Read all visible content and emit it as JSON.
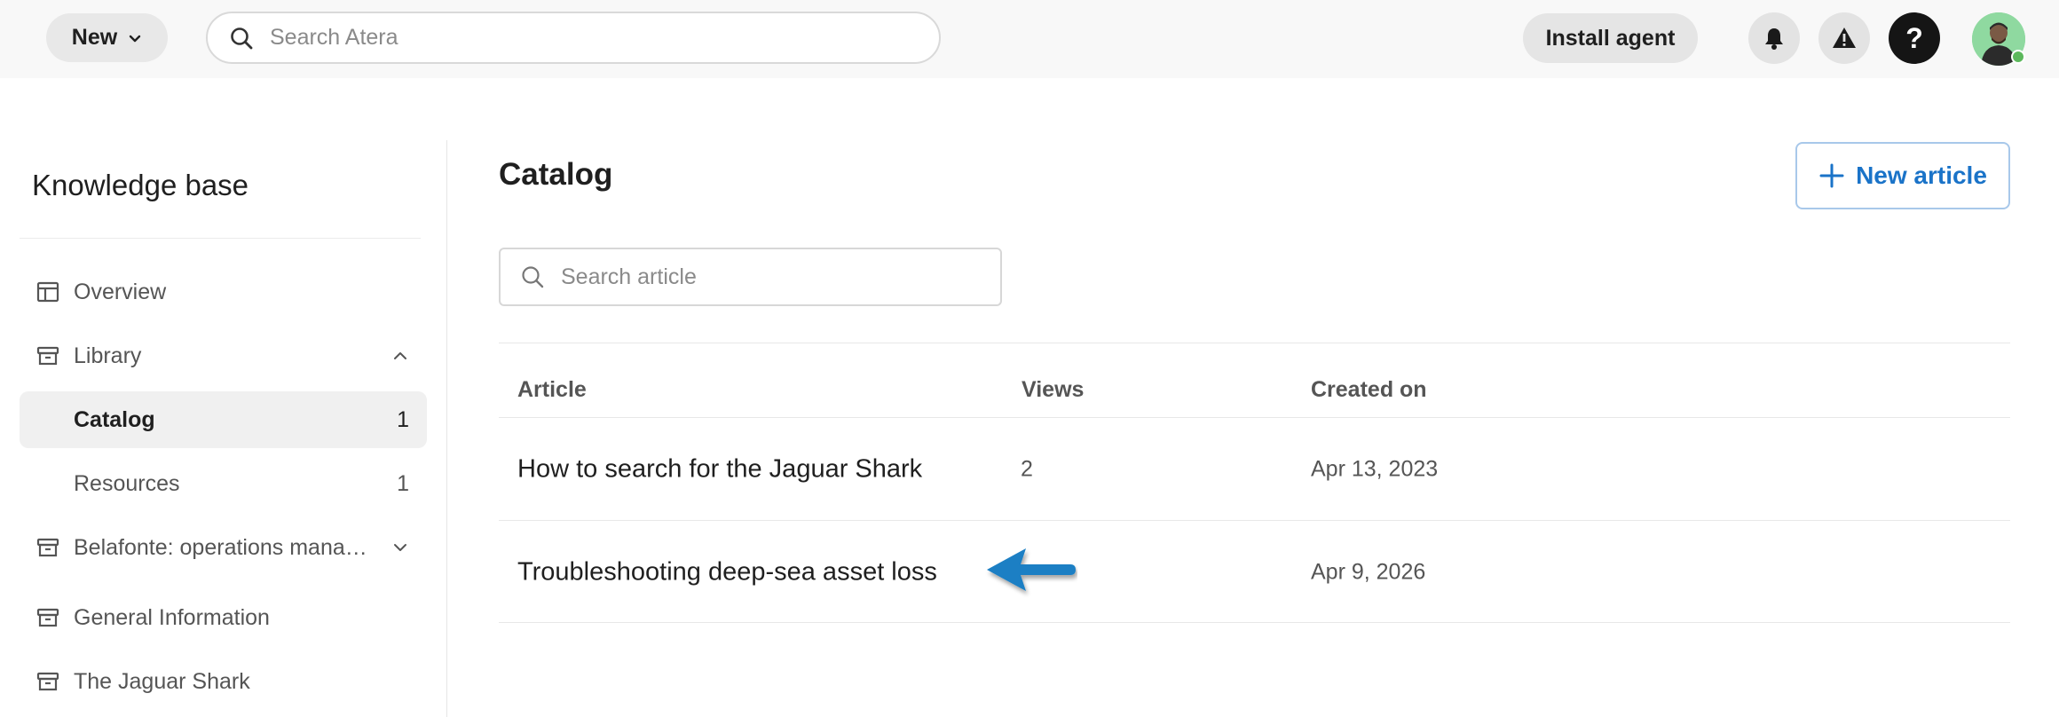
{
  "topbar": {
    "new_label": "New",
    "search_placeholder": "Search Atera",
    "install_label": "Install agent",
    "help_label": "?"
  },
  "sidebar": {
    "title": "Knowledge base",
    "items": [
      {
        "label": "Overview",
        "icon": "layout-icon"
      },
      {
        "label": "Library",
        "icon": "archive-icon",
        "expanded": true
      },
      {
        "label": "Catalog",
        "count": "1",
        "active": true
      },
      {
        "label": "Resources",
        "count": "1"
      },
      {
        "label": "Belafonte: operations mana…",
        "icon": "archive-icon",
        "expanded": false
      },
      {
        "label": "General Information",
        "icon": "archive-icon"
      },
      {
        "label": "The Jaguar Shark",
        "icon": "archive-icon"
      }
    ]
  },
  "main": {
    "title": "Catalog",
    "new_article_label": "New article",
    "search_placeholder": "Search article",
    "columns": [
      "Article",
      "Views",
      "Created on"
    ],
    "rows": [
      {
        "title": "How to search for the Jaguar Shark",
        "views": "2",
        "created": "Apr 13, 2023"
      },
      {
        "title": "Troubleshooting deep-sea asset loss",
        "views": "",
        "created": "Apr 9, 2026"
      }
    ]
  },
  "colors": {
    "accent": "#1a73c8",
    "arrow": "#1a7fc4",
    "active_bg": "#f0f0f0",
    "topbar_bg": "#f8f8f8"
  }
}
